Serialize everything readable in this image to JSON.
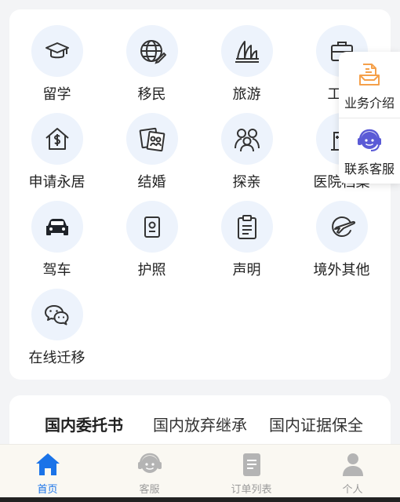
{
  "services": [
    {
      "label": "留学",
      "icon": "graduation-cap-icon"
    },
    {
      "label": "移民",
      "icon": "globe-pen-icon"
    },
    {
      "label": "旅游",
      "icon": "opera-house-icon"
    },
    {
      "label": "工作",
      "icon": "briefcase-icon"
    },
    {
      "label": "申请永居",
      "icon": "house-dollar-icon"
    },
    {
      "label": "结婚",
      "icon": "marriage-photo-icon"
    },
    {
      "label": "探亲",
      "icon": "family-icon"
    },
    {
      "label": "医院档案",
      "icon": "hospital-building-icon"
    },
    {
      "label": "驾车",
      "icon": "car-icon"
    },
    {
      "label": "护照",
      "icon": "passport-icon"
    },
    {
      "label": "声明",
      "icon": "clipboard-icon"
    },
    {
      "label": "境外其他",
      "icon": "overseas-icon"
    },
    {
      "label": "在线迁移",
      "icon": "wechat-icon"
    }
  ],
  "float_panel": {
    "intro_label": "业务介绍",
    "support_label": "联系客服"
  },
  "tabs": [
    {
      "label": "国内委托书",
      "active": true
    },
    {
      "label": "国内放弃继承",
      "active": false
    },
    {
      "label": "国内证据保全",
      "active": false
    }
  ],
  "bottom_nav": [
    {
      "label": "首页",
      "icon": "home-icon",
      "active": true
    },
    {
      "label": "客服",
      "icon": "headset-icon",
      "active": false
    },
    {
      "label": "订单列表",
      "icon": "document-icon",
      "active": false
    },
    {
      "label": "个人",
      "icon": "user-icon",
      "active": false
    }
  ],
  "colors": {
    "accent": "#1a73e8",
    "icon_bg": "#edf3fc",
    "intro_icon": "#f5a04a",
    "support_icon": "#5b5bd6"
  }
}
